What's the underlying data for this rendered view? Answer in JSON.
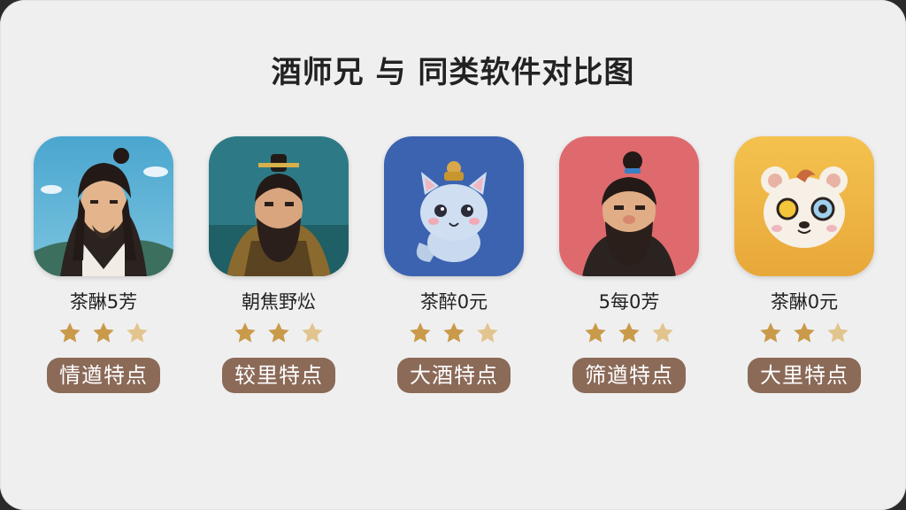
{
  "title": "酒师兄 与 同类软件对比图",
  "apps": [
    {
      "name": "茶醂5芳",
      "tag": "情遒特点",
      "rating": 3,
      "icon": "long-haired-swordsman-icon"
    },
    {
      "name": "朝焦野炂",
      "tag": "较里特点",
      "rating": 3,
      "icon": "bearded-general-icon"
    },
    {
      "name": "茶醉0元",
      "tag": "大酒特点",
      "rating": 3,
      "icon": "blue-cat-mascot-icon"
    },
    {
      "name": "5每0芳",
      "tag": "筛遒特点",
      "rating": 3,
      "icon": "bearded-topknot-man-icon"
    },
    {
      "name": "茶醂0元",
      "tag": "大里特点",
      "rating": 3,
      "icon": "monocle-bear-mascot-icon"
    }
  ],
  "colors": {
    "star_full": "#c99a4a",
    "star_light": "#e2c48e",
    "tag_bg": "#8b6a58"
  }
}
